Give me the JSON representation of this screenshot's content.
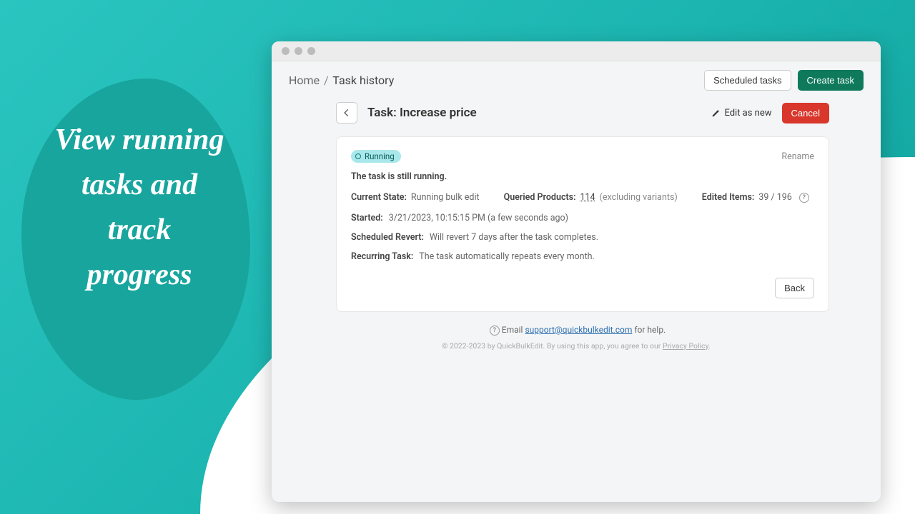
{
  "promo": "View running tasks and track progress",
  "breadcrumb": {
    "home": "Home",
    "current": "Task history"
  },
  "topbuttons": {
    "scheduled": "Scheduled tasks",
    "create": "Create task"
  },
  "taskheader": {
    "title": "Task: Increase price",
    "edit_as_new": "Edit as new",
    "cancel": "Cancel"
  },
  "card": {
    "badge": "Running",
    "rename": "Rename",
    "running_msg": "The task is still running.",
    "current_state": {
      "label": "Current State:",
      "value": "Running bulk edit"
    },
    "queried": {
      "label": "Queried Products:",
      "link": "114",
      "paren": "(excluding variants)"
    },
    "edited": {
      "label": "Edited Items:",
      "value": "39 / 196"
    },
    "started": {
      "label": "Started:",
      "value": "3/21/2023, 10:15:15 PM (a few seconds ago)"
    },
    "revert": {
      "label": "Scheduled Revert:",
      "value": "Will revert 7 days after the task completes."
    },
    "recurring": {
      "label": "Recurring Task:",
      "value": "The task automatically repeats every month."
    },
    "back": "Back"
  },
  "footer": {
    "prefix": "Email ",
    "email": "support@quickbulkedit.com",
    "suffix": " for help."
  },
  "copyright": {
    "text": "© 2022-2023 by QuickBulkEdit. By using this app, you agree to our ",
    "link": "Privacy Policy",
    "end": "."
  }
}
